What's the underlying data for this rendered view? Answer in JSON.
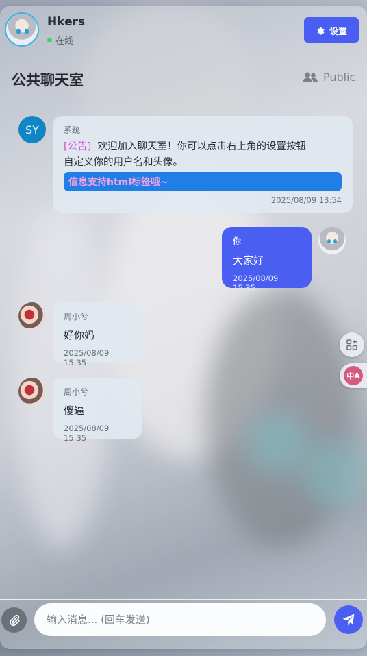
{
  "header": {
    "username": "Hkers",
    "status": "在线",
    "settings_label": "设置"
  },
  "room": {
    "title": "公共聊天室",
    "type": "Public"
  },
  "messages": [
    {
      "sender": "SY",
      "sender_name": "系统",
      "tag": "[公告]",
      "line1": "欢迎加入聊天室！你可以点击右上角的设置按钮",
      "line2": "自定义你的用户名和头像。",
      "highlight": "信息支持html标签哦~",
      "time": "2025/08/09 13:54"
    },
    {
      "sender_name": "你",
      "text": "大家好",
      "time": "2025/08/09 15:35"
    },
    {
      "sender_name": "周小兮",
      "text": "好你妈",
      "time": "2025/08/09 15:35"
    },
    {
      "sender_name": "周小兮",
      "text": "傻逼",
      "time": "2025/08/09 15:35"
    }
  ],
  "side": {
    "translate_label": "中A"
  },
  "input": {
    "placeholder": "输入消息... (回车发送)"
  },
  "colors": {
    "accent": "#4a5ff2",
    "online": "#3ad16a",
    "system_avatar": "#1186c4",
    "announce_tag": "#d84fd6",
    "highlight_bg": "#1f7fe6",
    "highlight_text": "#f7a0e6"
  },
  "icons": [
    "gear-icon",
    "users-icon",
    "apps-icon",
    "translate-icon",
    "paperclip-icon",
    "send-icon"
  ]
}
